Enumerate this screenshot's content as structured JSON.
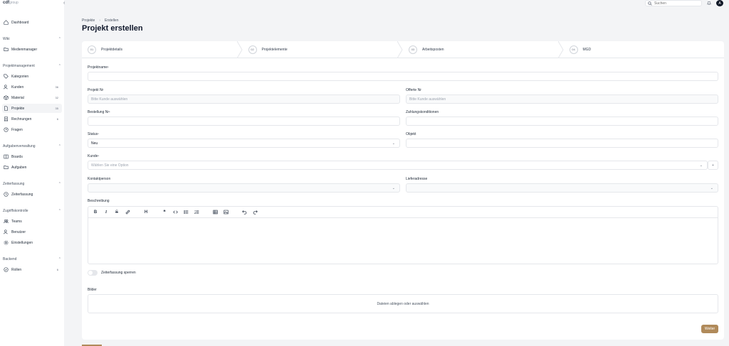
{
  "app": {
    "logo": "cdf",
    "logo_sub": "group"
  },
  "sidebar": {
    "dashboard": "Dashboard",
    "sections": {
      "wiki": "Wiki",
      "projektmanagement": "Projektmanagement",
      "aufgabenverwaltung": "Aufgabenverwaltung",
      "zeiterfassung": "Zeiterfassung",
      "zugriffskontrolle": "Zugriffskontrolle",
      "backend": "Backend"
    },
    "items": {
      "medienmanager": "Medienmanager",
      "kategorien": "Kategorien",
      "kunden": "Kunden",
      "kunden_count": "36",
      "material": "Material",
      "material_count": "32",
      "projekte": "Projekte",
      "projekte_count": "35",
      "rechnungen": "Rechnungen",
      "rechnungen_count": "6",
      "fragen": "Fragen",
      "boards": "Boards",
      "aufgaben": "Aufgaben",
      "zeiterfassung": "Zeiterfassung",
      "teams": "Teams",
      "benutzer": "Benutzer",
      "einstellungen": "Einstellungen",
      "rollen": "Rollen",
      "rollen_count": "6"
    }
  },
  "topbar": {
    "search_placeholder": "Suchen",
    "avatar_initial": "A"
  },
  "breadcrumb": {
    "parent": "Projekte",
    "current": "Erstellen"
  },
  "page_title": "Projekt erstellen",
  "steps": [
    {
      "num": "01",
      "label": "Projektdetails"
    },
    {
      "num": "02",
      "label": "Projektelemente"
    },
    {
      "num": "03",
      "label": "Arbeitsposten"
    },
    {
      "num": "04",
      "label": "MGD"
    }
  ],
  "form": {
    "projektname": "Projektname",
    "projekt_nr": "Projekt Nr",
    "projekt_nr_placeholder": "Bitte Kunde auswählen",
    "offerte_nr": "Offerte Nr",
    "offerte_nr_placeholder": "Bitte Kunde auswählen",
    "bestellung_nr": "Bestellung Nr",
    "zahlungskonditionen": "Zahlungskonditionen",
    "status": "Status",
    "status_value": "Neu",
    "objekt": "Objekt",
    "kunde": "Kunde",
    "kunde_placeholder": "Wählen Sie eine Option",
    "kontaktperson": "Kontaktperson",
    "lieferadresse": "Lieferadresse",
    "beschreibung": "Beschreibung",
    "toggle_label": "Zeiterfassung sperren",
    "bilder": "Bilder",
    "dropzone": "Dateien ablegen oder auswählen",
    "required_mark": "*",
    "next_button": "Weiter"
  },
  "colors": {
    "accent": "#b08a5a",
    "background": "#f3f4f6",
    "card": "#ffffff"
  }
}
